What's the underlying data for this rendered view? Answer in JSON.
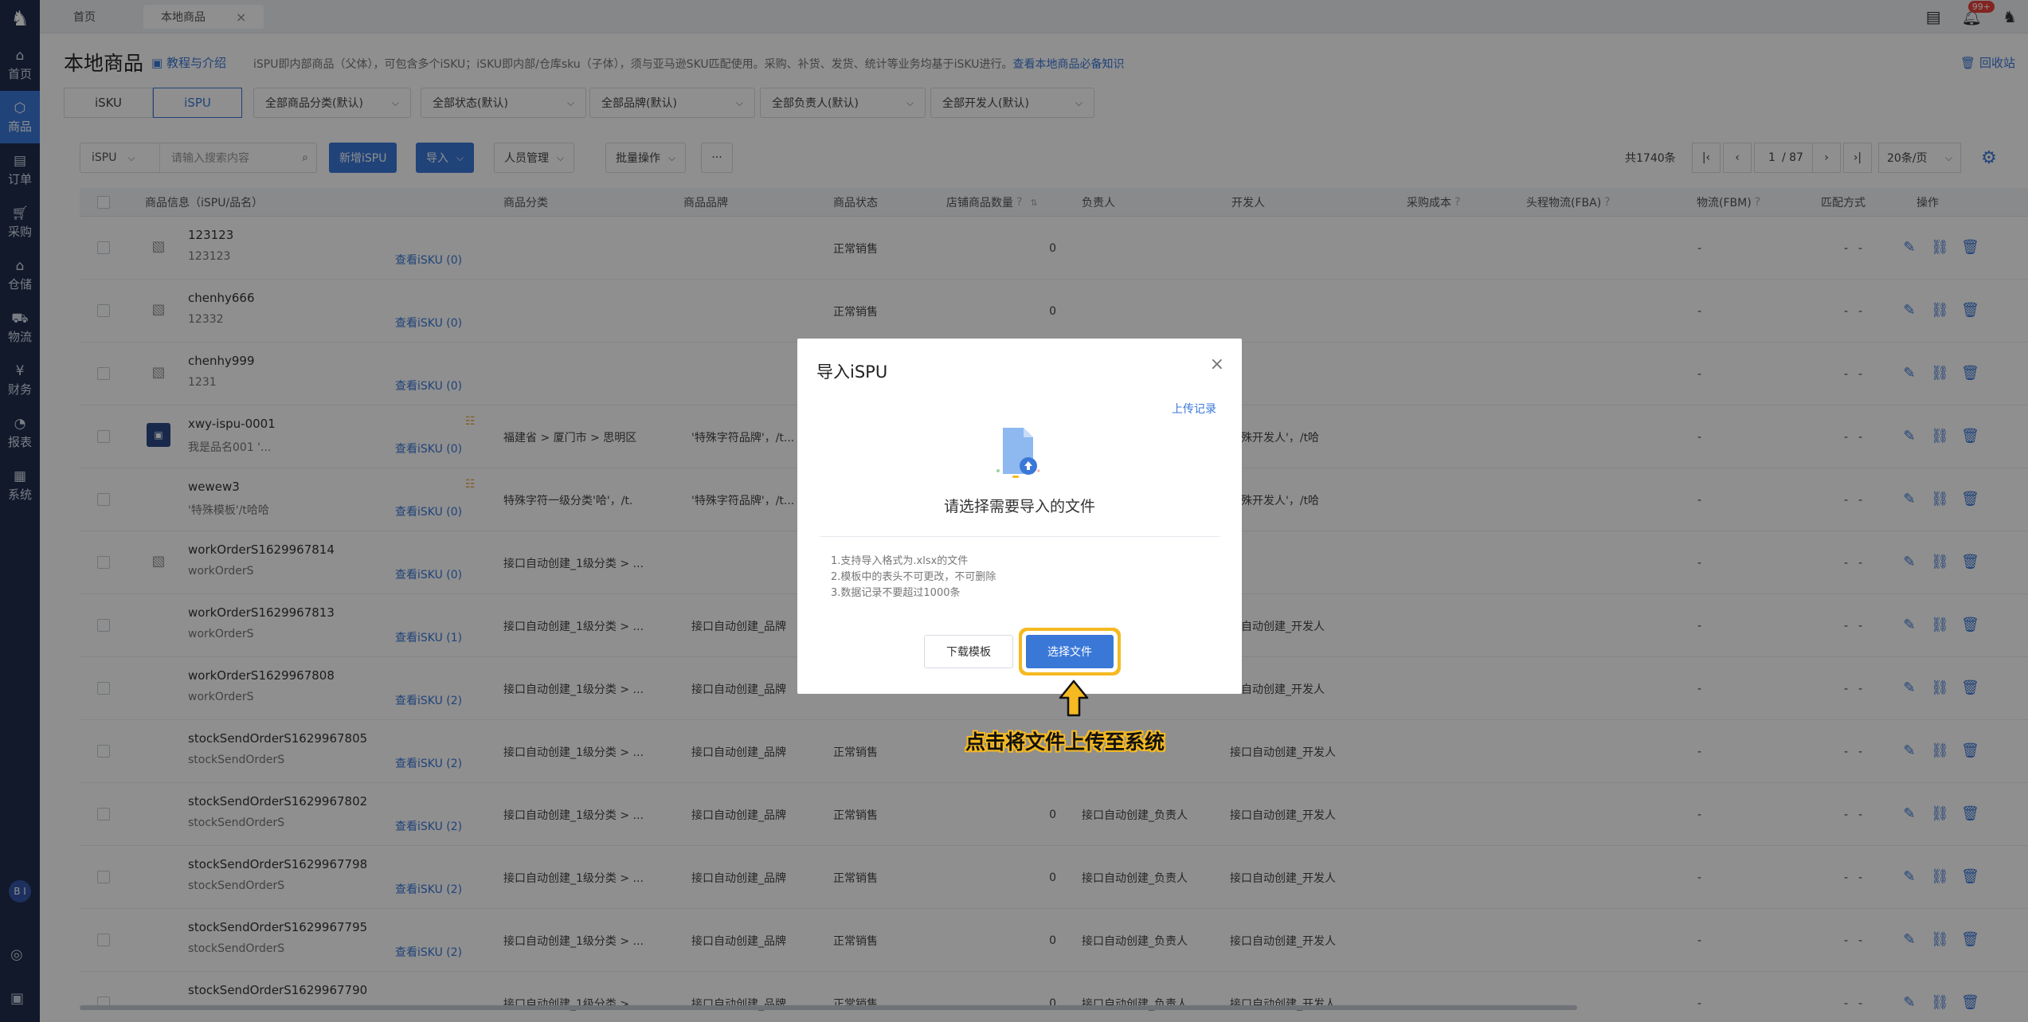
{
  "tabs": [
    {
      "label": "首页"
    },
    {
      "label": "本地商品"
    }
  ],
  "notification_count": "99+",
  "sidebar": {
    "items": [
      {
        "label": "首页",
        "icon": "home-icon"
      },
      {
        "label": "商品",
        "icon": "product-icon"
      },
      {
        "label": "订单",
        "icon": "order-icon"
      },
      {
        "label": "采购",
        "icon": "cart-icon"
      },
      {
        "label": "仓储",
        "icon": "warehouse-icon"
      },
      {
        "label": "物流",
        "icon": "truck-icon"
      },
      {
        "label": "财务",
        "icon": "finance-icon"
      },
      {
        "label": "报表",
        "icon": "chart-icon"
      },
      {
        "label": "系统",
        "icon": "system-icon"
      }
    ],
    "bi_label": "B I"
  },
  "header": {
    "title": "本地商品",
    "tutorial": "教程与介绍",
    "description": "iSPU即内部商品（父体），可包含多个iSKU；iSKU即内部/仓库sku（子体），须与亚马逊SKU匹配使用。采购、补货、发货、统计等业务均基于iSKU进行。",
    "knowledge_link": "查看本地商品必备知识",
    "recycle": "回收站"
  },
  "filters": {
    "seg_isku": "iSKU",
    "seg_ispu": "iSPU",
    "category": "全部商品分类(默认)",
    "status": "全部状态(默认)",
    "brand": "全部品牌(默认)",
    "owner": "全部负责人(默认)",
    "developer": "全部开发人(默认)"
  },
  "toolbar": {
    "search_type": "iSPU",
    "search_placeholder": "请输入搜索内容",
    "add": "新增iSPU",
    "import": "导入",
    "staff": "人员管理",
    "batch": "批量操作",
    "more": "···",
    "total": "共1740条",
    "page_current": "1",
    "page_total": "/ 87",
    "page_size": "20条/页"
  },
  "table": {
    "headers": {
      "info": "商品信息（iSPU/品名）",
      "category": "商品分类",
      "brand": "商品品牌",
      "status": "商品状态",
      "store_qty": "店铺商品数量",
      "owner": "负责人",
      "developer": "开发人",
      "cost": "采购成本",
      "fba": "头程物流(FBA)",
      "fbm": "物流(FBM)",
      "match": "匹配方式",
      "ops": "操作"
    },
    "rows": [
      {
        "name": "123123",
        "sub": "123123",
        "sku": "查看iSKU (0)",
        "category": "",
        "brand": "",
        "status": "正常销售",
        "qty": "0",
        "owner": "",
        "dev": "",
        "fba": "-",
        "fbm": "-",
        "match": "-"
      },
      {
        "name": "chenhy666",
        "sub": "12332",
        "sku": "查看iSKU (0)",
        "category": "",
        "brand": "",
        "status": "正常销售",
        "qty": "0",
        "owner": "",
        "dev": "",
        "fba": "-",
        "fbm": "-",
        "match": "-"
      },
      {
        "name": "chenhy999",
        "sub": "1231",
        "sku": "查看iSKU (0)",
        "category": "",
        "brand": "",
        "status": "",
        "qty": "",
        "owner": "",
        "dev": "",
        "fba": "-",
        "fbm": "-",
        "match": "-"
      },
      {
        "name": "xwy-ispu-0001",
        "sub": "我是品名001 '...",
        "sku": "查看iSKU (0)",
        "category": "福建省 > 厦门市 > 思明区",
        "brand": "'特殊字符品牌'，/t...",
        "status": "",
        "qty": "",
        "owner": "",
        "dev": "特殊开发人'，/t哈",
        "fba": "-",
        "fbm": "-",
        "match": "-"
      },
      {
        "name": "wewew3",
        "sub": "'特殊模板'/t哈哈",
        "sku": "查看iSKU (0)",
        "category": "特殊字符一级分类'哈'，/t.",
        "brand": "'特殊字符品牌'，/t...",
        "status": "",
        "qty": "",
        "owner": "",
        "dev": "特殊开发人'，/t哈",
        "fba": "-",
        "fbm": "-",
        "match": "-"
      },
      {
        "name": "workOrderS1629967814",
        "sub": "workOrderS",
        "sku": "查看iSKU (0)",
        "category": "接口自动创建_1级分类 > ...",
        "brand": "",
        "status": "",
        "qty": "",
        "owner": "",
        "dev": "",
        "fba": "-",
        "fbm": "-",
        "match": "-"
      },
      {
        "name": "workOrderS1629967813",
        "sub": "workOrderS",
        "sku": "查看iSKU (1)",
        "category": "接口自动创建_1级分类 > ...",
        "brand": "接口自动创建_品牌",
        "status": "",
        "qty": "",
        "owner": "",
        "dev": "口自动创建_开发人",
        "fba": "-",
        "fbm": "-",
        "match": "-"
      },
      {
        "name": "workOrderS1629967808",
        "sub": "workOrderS",
        "sku": "查看iSKU (2)",
        "category": "接口自动创建_1级分类 > ...",
        "brand": "接口自动创建_品牌",
        "status": "",
        "qty": "",
        "owner": "",
        "dev": "口自动创建_开发人",
        "fba": "-",
        "fbm": "-",
        "match": "-"
      },
      {
        "name": "stockSendOrderS1629967805",
        "sub": "stockSendOrderS",
        "sku": "查看iSKU (2)",
        "category": "接口自动创建_1级分类 > ...",
        "brand": "接口自动创建_品牌",
        "status": "正常销售",
        "qty": "",
        "owner": "",
        "dev": "接口自动创建_开发人",
        "fba": "-",
        "fbm": "-",
        "match": "-"
      },
      {
        "name": "stockSendOrderS1629967802",
        "sub": "stockSendOrderS",
        "sku": "查看iSKU (2)",
        "category": "接口自动创建_1级分类 > ...",
        "brand": "接口自动创建_品牌",
        "status": "正常销售",
        "qty": "0",
        "owner": "接口自动创建_负责人",
        "dev": "接口自动创建_开发人",
        "fba": "-",
        "fbm": "-",
        "match": "-"
      },
      {
        "name": "stockSendOrderS1629967798",
        "sub": "stockSendOrderS",
        "sku": "查看iSKU (2)",
        "category": "接口自动创建_1级分类 > ...",
        "brand": "接口自动创建_品牌",
        "status": "正常销售",
        "qty": "0",
        "owner": "接口自动创建_负责人",
        "dev": "接口自动创建_开发人",
        "fba": "-",
        "fbm": "-",
        "match": "-"
      },
      {
        "name": "stockSendOrderS1629967795",
        "sub": "stockSendOrderS",
        "sku": "查看iSKU (2)",
        "category": "接口自动创建_1级分类 > ...",
        "brand": "接口自动创建_品牌",
        "status": "正常销售",
        "qty": "0",
        "owner": "接口自动创建_负责人",
        "dev": "接口自动创建_开发人",
        "fba": "-",
        "fbm": "-",
        "match": "-"
      },
      {
        "name": "stockSendOrderS1629967790",
        "sub": "",
        "sku": "",
        "category": "接口自动创建_1级分类 > ...",
        "brand": "接口自动创建_品牌",
        "status": "正常销售",
        "qty": "0",
        "owner": "接口自动创建_负责人",
        "dev": "接口自动创建_开发人",
        "fba": "-",
        "fbm": "-",
        "match": "-"
      }
    ]
  },
  "modal": {
    "title": "导入iSPU",
    "history": "上传记录",
    "prompt": "请选择需要导入的文件",
    "notes": [
      "1.支持导入格式为.xlsx的文件",
      "2.模板中的表头不可更改，不可删除",
      "3.数据记录不要超过1000条"
    ],
    "download_template": "下载模板",
    "choose_file": "选择文件"
  },
  "callout": "点击将文件上传至系统",
  "colors": {
    "primary": "#3a78d8",
    "sidebar": "#1f2e4d",
    "highlight": "#f5b921"
  }
}
